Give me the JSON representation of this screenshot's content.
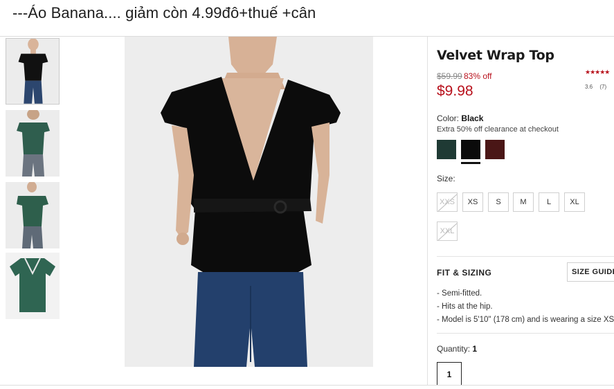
{
  "post": {
    "caption": "---Áo Banana.... giảm còn 4.99đô+thuế +cân"
  },
  "product": {
    "title": "Velvet Wrap Top",
    "original_price": "$59.99",
    "discount": "83% off",
    "sale_price": "$9.98",
    "rating": {
      "stars": "★★★★★",
      "value": "3.6",
      "count": "(7)"
    }
  },
  "color": {
    "label": "Color:",
    "selected": "Black",
    "promo": "Extra 50% off clearance at checkout",
    "swatches": [
      {
        "name": "green",
        "hex": "#1f3a34"
      },
      {
        "name": "black",
        "hex": "#0b0b0b"
      },
      {
        "name": "burgundy",
        "hex": "#4a1616"
      }
    ]
  },
  "size": {
    "label": "Size:",
    "options": [
      "XXS",
      "XS",
      "S",
      "M",
      "L",
      "XL",
      "XXL"
    ],
    "unavailable": [
      "XXS",
      "XXL"
    ]
  },
  "fit": {
    "title": "FIT & SIZING",
    "size_guide": "SIZE GUIDE",
    "bullets": [
      "- Semi-fitted.",
      "- Hits at the hip.",
      "- Model is 5'10\" (178 cm) and is wearing a size XS."
    ]
  },
  "quantity": {
    "label": "Quantity:",
    "value": "1",
    "box_value": "1"
  },
  "colors": {
    "sale_red": "#b8111c",
    "image_bg": "#ededed"
  },
  "thumbnails": [
    {
      "icon": "front-black-photo"
    },
    {
      "icon": "back-green-photo"
    },
    {
      "icon": "front-green-photo"
    },
    {
      "icon": "flat-green-photo"
    }
  ]
}
